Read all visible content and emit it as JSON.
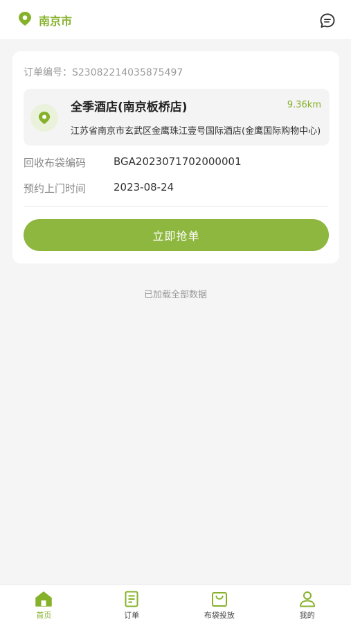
{
  "header": {
    "city": "南京市",
    "city_icon": "location-pin-icon",
    "message_icon": "chat-bubble-icon"
  },
  "order": {
    "order_no_label": "订单编号：",
    "order_no": "S2308221403587549 7",
    "store_name": "全季酒店(南京板桥店)",
    "distance": "9.36km",
    "address": "江苏省南京市玄武区金鹰珠江壹号国际酒店(金鹰国际购物中心)",
    "bag_code_label": "回收布袋编码",
    "bag_code": "BGA2023071702000001",
    "appointment_label": "预约上门时间",
    "appointment_date": "2023-08-24",
    "grab_button": "立即抢单"
  },
  "list_status": "已加载全部数据",
  "tabs": [
    {
      "label": "首页",
      "icon": "home-icon",
      "active": true
    },
    {
      "label": "订单",
      "icon": "order-document-icon",
      "active": false
    },
    {
      "label": "布袋投放",
      "icon": "bag-icon",
      "active": false
    },
    {
      "label": "我的",
      "icon": "user-icon",
      "active": false
    }
  ],
  "colors": {
    "accent": "#8db73e",
    "background": "#f5f5f5",
    "card": "#ffffff"
  }
}
